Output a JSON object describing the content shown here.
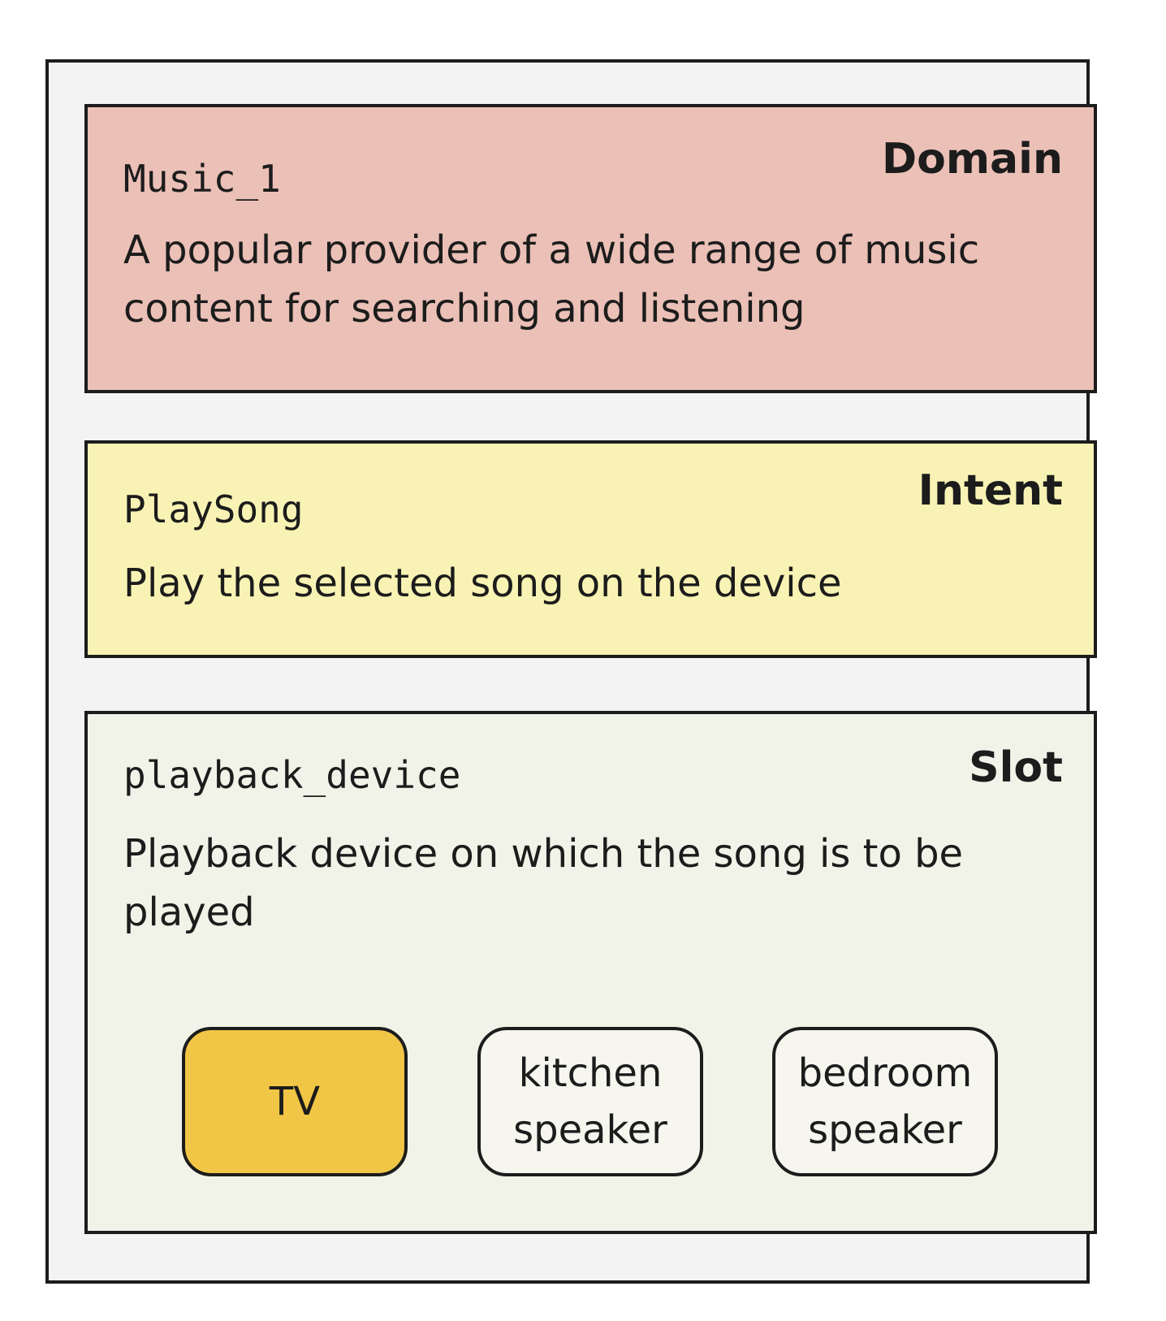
{
  "domain": {
    "kind_label": "Domain",
    "name": "Music_1",
    "description": "A popular provider of a wide range of music content for searching and listening",
    "color": "#ebc0b6"
  },
  "intent": {
    "kind_label": "Intent",
    "name": "PlaySong",
    "description": "Play the selected song on the device",
    "color": "#f8f3b4"
  },
  "slot": {
    "kind_label": "Slot",
    "name": "playback_device",
    "description": "Playback device on which the song is to be played",
    "color": "#f2f3e8",
    "values": [
      {
        "label": "TV",
        "selected": true
      },
      {
        "label": "kitchen speaker",
        "selected": false
      },
      {
        "label": "bedroom speaker",
        "selected": false
      }
    ],
    "selected_color": "#f1c646"
  }
}
